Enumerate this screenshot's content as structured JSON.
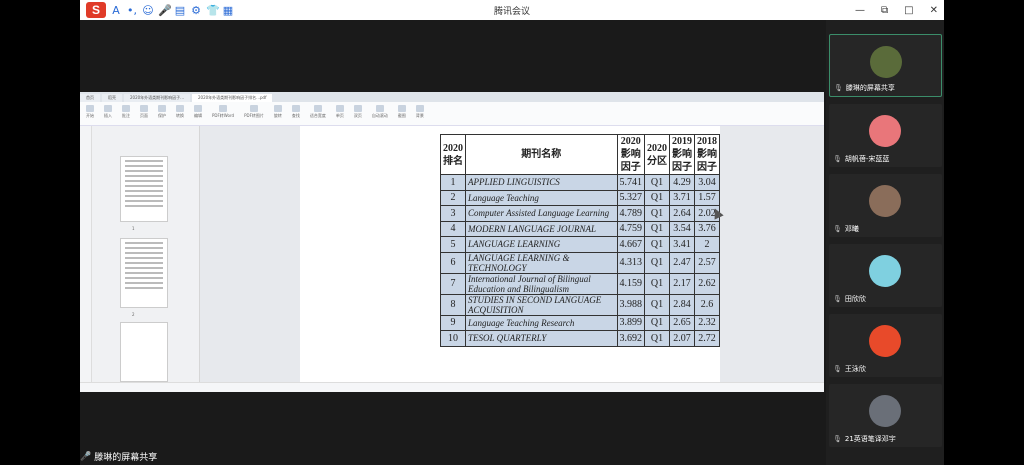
{
  "window": {
    "title": "腾讯会议",
    "ime_logo": "S",
    "ime_icons": [
      "A",
      "•,",
      "☺",
      "🎤",
      "▤",
      "⚙",
      "👕",
      "▦"
    ],
    "controls": [
      "—",
      "⧉",
      "□",
      "✕"
    ]
  },
  "shared_screen": {
    "tabs": [
      "首页",
      "稻壳",
      "2020年外语类期刊影响因子...",
      "2020年外语类期刊影响因子排名...pdf"
    ],
    "ribbon": [
      "开始",
      "插入",
      "批注",
      "页面",
      "保护",
      "转换",
      "编辑",
      "PDF转Word",
      "PDF转图片",
      "旋转",
      "查找",
      "适合宽度",
      "单页",
      "双页",
      "自动滚动",
      "截图",
      "背景"
    ],
    "thumb_labels": [
      "1",
      "2"
    ],
    "table": {
      "headers": [
        "2020\n排名",
        "期刊名称",
        "2020\n影响\n因子",
        "2020\n分区",
        "2019\n影响\n因子",
        "2018\n影响\n因子"
      ],
      "rows": [
        {
          "rank": "1",
          "name": "APPLIED LINGUISTICS",
          "if2020": "5.741",
          "q": "Q1",
          "if2019": "4.29",
          "if2018": "3.04"
        },
        {
          "rank": "2",
          "name": "Language Teaching",
          "if2020": "5.327",
          "q": "Q1",
          "if2019": "3.71",
          "if2018": "1.57"
        },
        {
          "rank": "3",
          "name": "Computer Assisted Language Learning",
          "if2020": "4.789",
          "q": "Q1",
          "if2019": "2.64",
          "if2018": "2.02"
        },
        {
          "rank": "4",
          "name": "MODERN LANGUAGE JOURNAL",
          "if2020": "4.759",
          "q": "Q1",
          "if2019": "3.54",
          "if2018": "3.76"
        },
        {
          "rank": "5",
          "name": "LANGUAGE LEARNING",
          "if2020": "4.667",
          "q": "Q1",
          "if2019": "3.41",
          "if2018": "2"
        },
        {
          "rank": "6",
          "name": "LANGUAGE LEARNING & TECHNOLOGY",
          "if2020": "4.313",
          "q": "Q1",
          "if2019": "2.47",
          "if2018": "2.57"
        },
        {
          "rank": "7",
          "name": "International Journal of Bilingual Education and Bilingualism",
          "if2020": "4.159",
          "q": "Q1",
          "if2019": "2.17",
          "if2018": "2.62"
        },
        {
          "rank": "8",
          "name": "STUDIES IN SECOND LANGUAGE ACQUISITION",
          "if2020": "3.988",
          "q": "Q1",
          "if2019": "2.84",
          "if2018": "2.6"
        },
        {
          "rank": "9",
          "name": "Language Teaching Research",
          "if2020": "3.899",
          "q": "Q1",
          "if2019": "2.65",
          "if2018": "2.32"
        },
        {
          "rank": "10",
          "name": "TESOL QUARTERLY",
          "if2020": "3.692",
          "q": "Q1",
          "if2019": "2.07",
          "if2018": "2.72"
        }
      ]
    }
  },
  "participants": [
    {
      "name": "滕琳的屏幕共享",
      "avatar_color": "#5a6b3a"
    },
    {
      "name": "胡帆蓓-宋蓝蓝",
      "avatar_color": "#e9767a"
    },
    {
      "name": "邓曦",
      "avatar_color": "#8a6d5a"
    },
    {
      "name": "田欣欣",
      "avatar_color": "#7fd0e0"
    },
    {
      "name": "王泳欣",
      "avatar_color": "#e84a2a"
    },
    {
      "name": "21英语笔译邓宇",
      "avatar_color": "#6a6f78"
    }
  ],
  "bottom_label": "滕琳的屏幕共享"
}
